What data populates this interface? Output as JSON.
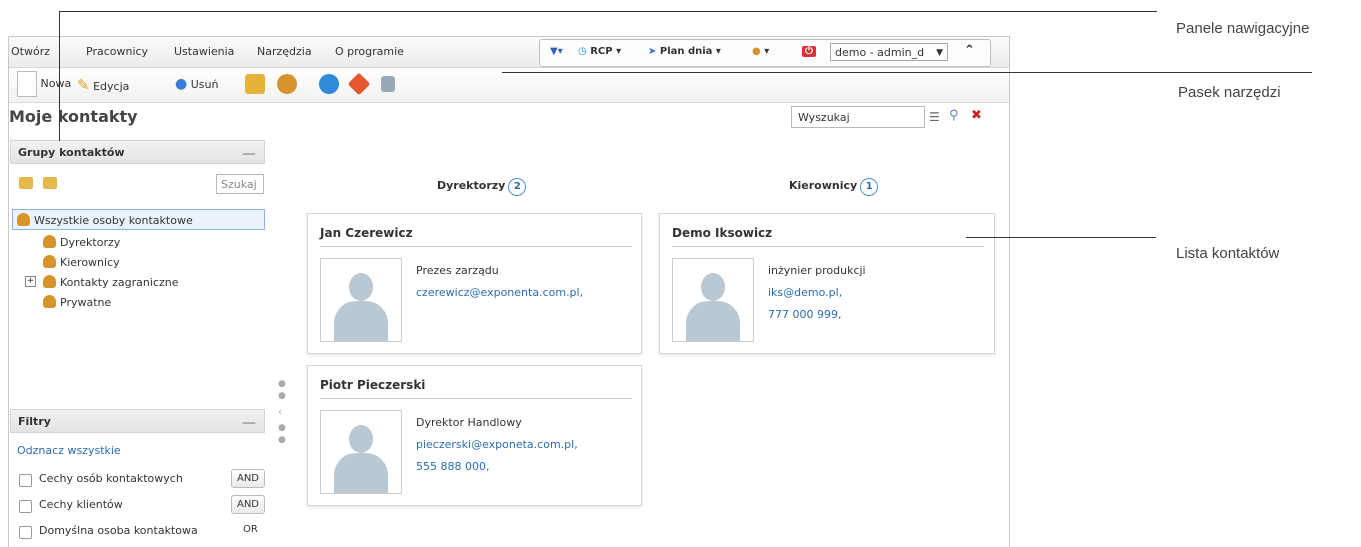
{
  "menu": [
    "Otwórz",
    "Pracownicy",
    "Ustawienia",
    "Narzędzia",
    "O programie"
  ],
  "topbar": {
    "rcp": "RCP",
    "plan": "Plan dnia",
    "user": "demo - admin_d"
  },
  "toolbar": {
    "new": "Nowa",
    "edit": "Edycja",
    "delete": "Usuń"
  },
  "page_title": "Moje kontakty",
  "search": {
    "placeholder": "Wyszukaj"
  },
  "groups": {
    "header": "Grupy kontaktów",
    "search_placeholder": "Szukaj",
    "tree": [
      "Wszystkie osoby kontaktowe",
      "Dyrektorzy",
      "Kierownicy",
      "Kontakty zagraniczne",
      "Prywatne"
    ]
  },
  "filters": {
    "header": "Filtry",
    "uncheck_all": "Odznacz wszystkie",
    "items": [
      {
        "label": "Cechy osób kontaktowych",
        "op": "AND"
      },
      {
        "label": "Cechy klientów",
        "op": "AND"
      },
      {
        "label": "Domyślna osoba kontaktowa",
        "op": "OR"
      }
    ]
  },
  "columns": [
    {
      "title": "Dyrektorzy",
      "count": "2"
    },
    {
      "title": "Kierownicy",
      "count": "1"
    }
  ],
  "cards": [
    {
      "name": "Jan Czerewicz",
      "role": "Prezes zarządu",
      "email": "czerewicz@exponenta.com.pl,",
      "phone": ""
    },
    {
      "name": "Demo Iksowicz",
      "role": "inżynier produkcji",
      "email": "iks@demo.pl,",
      "phone": "777 000 999,"
    },
    {
      "name": "Piotr Pieczerski",
      "role": "Dyrektor Handlowy",
      "email": "pieczerski@exponeta.com.pl,",
      "phone": "555 888 000,"
    }
  ],
  "callouts": {
    "nav": "Panele nawigacyjne",
    "toolbar": "Pasek narzędzi",
    "contacts": "Lista kontaktów"
  },
  "colors": {
    "link": "#2b6cb0",
    "badge": "#4a90d9",
    "delete": "#cc2222"
  }
}
